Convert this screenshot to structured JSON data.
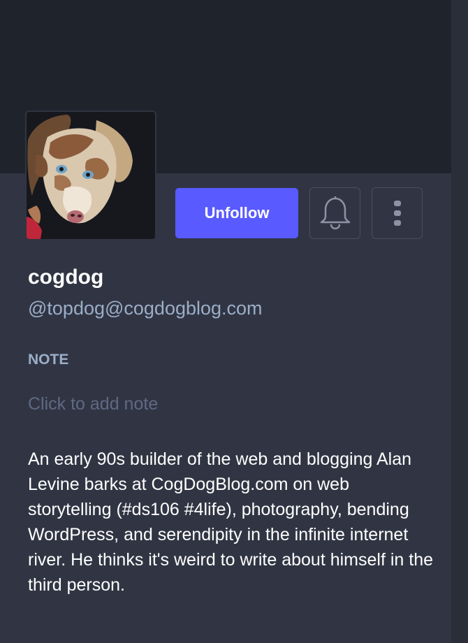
{
  "profile": {
    "display_name": "cogdog",
    "handle": "@topdog@cogdogblog.com",
    "note_label": "NOTE",
    "note_placeholder": "Click to add note",
    "bio": "An early 90s builder of the web and blogging Alan Levine barks at CogDogBlog.com on web storytelling (#ds106 #4life), photography, bending WordPress, and serendipity in the infinite internet river. He thinks it's weird to write about himself in the third person."
  },
  "actions": {
    "unfollow_label": "Unfollow",
    "bell_icon": "bell-icon",
    "menu_icon": "vertical-ellipsis-icon"
  },
  "colors": {
    "accent": "#595aff",
    "background": "#313543",
    "banner": "#1f232b",
    "muted_text": "#9baec8",
    "placeholder_text": "#606984"
  }
}
